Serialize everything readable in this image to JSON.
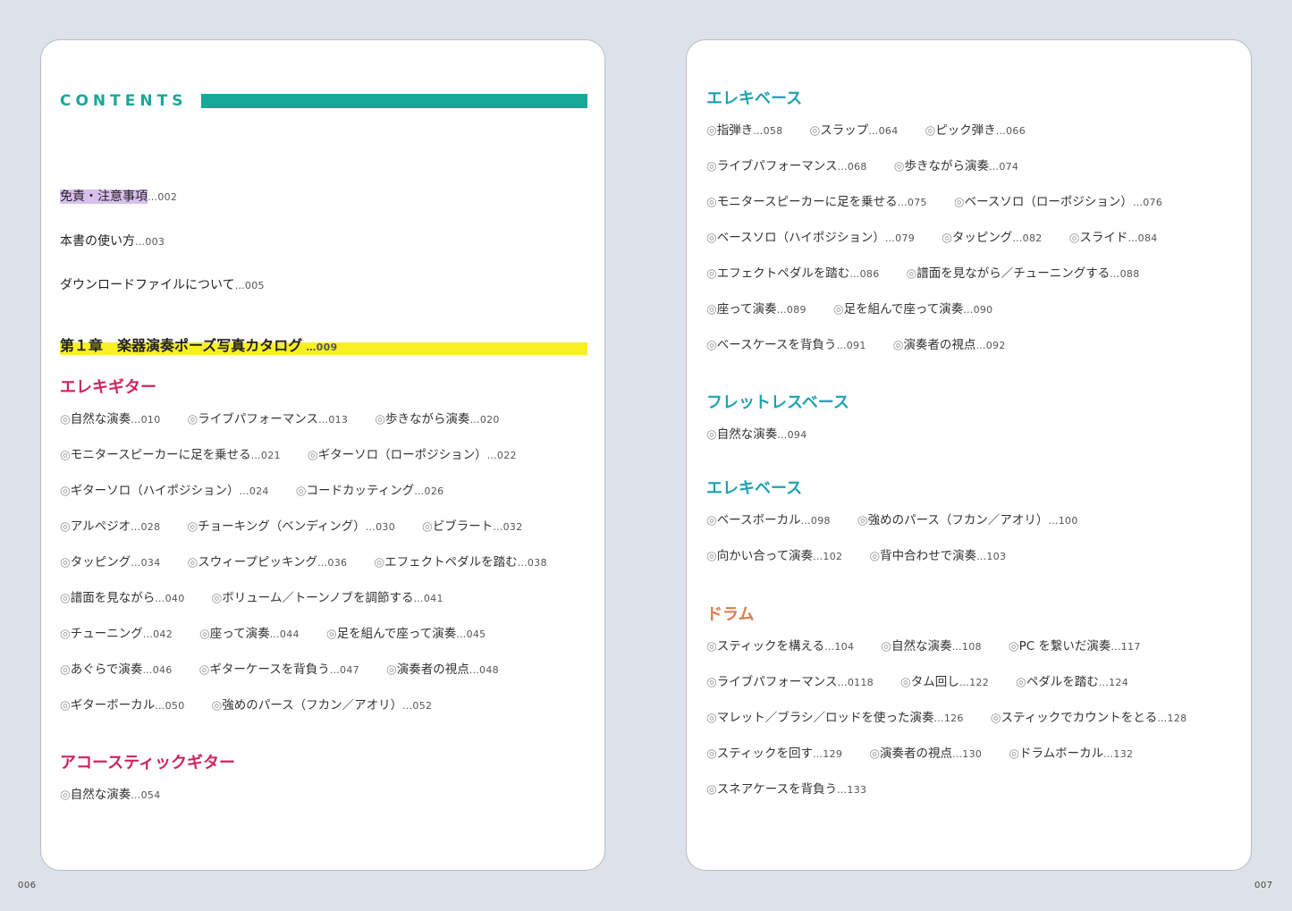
{
  "contents_title": "CONTENTS",
  "front_matter": [
    {
      "label": "免責・注意事項",
      "page": "002"
    },
    {
      "label": "本書の使い方",
      "page": "003"
    },
    {
      "label": "ダウンロードファイルについて",
      "page": "005"
    }
  ],
  "chapter": {
    "label": "第１章　楽器演奏ポーズ写真カタログ",
    "page": "009"
  },
  "sections": [
    {
      "title": "エレキギター",
      "rows": [
        [
          {
            "label": "自然な演奏",
            "page": "010"
          },
          {
            "label": "ライブパフォーマンス",
            "page": "013"
          },
          {
            "label": "歩きながら演奏",
            "page": "020"
          }
        ],
        [
          {
            "label": "モニタースピーカーに足を乗せる",
            "page": "021"
          },
          {
            "label": "ギターソロ（ローポジション）",
            "page": "022"
          }
        ],
        [
          {
            "label": "ギターソロ（ハイポジション）",
            "page": "024"
          },
          {
            "label": "コードカッティング",
            "page": "026"
          }
        ],
        [
          {
            "label": "アルペジオ",
            "page": "028"
          },
          {
            "label": "チョーキング（ベンディング）",
            "page": "030"
          },
          {
            "label": "ビブラート",
            "page": "032"
          }
        ],
        [
          {
            "label": "タッピング",
            "page": "034"
          },
          {
            "label": "スウィープピッキング",
            "page": "036"
          },
          {
            "label": "エフェクトペダルを踏む",
            "page": "038"
          }
        ],
        [
          {
            "label": "譜面を見ながら",
            "page": "040"
          },
          {
            "label": "ボリューム／トーンノブを調節する",
            "page": "041"
          }
        ],
        [
          {
            "label": "チューニング",
            "page": "042"
          },
          {
            "label": "座って演奏",
            "page": "044"
          },
          {
            "label": "足を組んで座って演奏",
            "page": "045"
          }
        ],
        [
          {
            "label": "あぐらで演奏",
            "page": "046"
          },
          {
            "label": "ギターケースを背負う",
            "page": "047"
          },
          {
            "label": "演奏者の視点",
            "page": "048"
          }
        ],
        [
          {
            "label": "ギターボーカル",
            "page": "050"
          },
          {
            "label": "強めのパース（フカン／アオリ）",
            "page": "052"
          }
        ]
      ]
    },
    {
      "title": "アコースティックギター",
      "rows": [
        [
          {
            "label": "自然な演奏",
            "page": "054"
          }
        ]
      ]
    },
    {
      "title": "エレキベース",
      "rows": [
        [
          {
            "label": "指弾き",
            "page": "058"
          },
          {
            "label": "スラップ",
            "page": "064"
          },
          {
            "label": "ピック弾き",
            "page": "066"
          }
        ],
        [
          {
            "label": "ライブパフォーマンス",
            "page": "068"
          },
          {
            "label": "歩きながら演奏",
            "page": "074"
          }
        ],
        [
          {
            "label": "モニタースピーカーに足を乗せる",
            "page": "075"
          },
          {
            "label": "ベースソロ（ローポジション）",
            "page": "076"
          }
        ],
        [
          {
            "label": "ベースソロ（ハイポジション）",
            "page": "079"
          },
          {
            "label": "タッピング",
            "page": "082"
          },
          {
            "label": "スライド",
            "page": "084"
          }
        ],
        [
          {
            "label": "エフェクトペダルを踏む",
            "page": "086"
          },
          {
            "label": "譜面を見ながら／チューニングする",
            "page": "088"
          }
        ],
        [
          {
            "label": "座って演奏",
            "page": "089"
          },
          {
            "label": "足を組んで座って演奏",
            "page": "090"
          }
        ],
        [
          {
            "label": "ベースケースを背負う",
            "page": "091"
          },
          {
            "label": "演奏者の視点",
            "page": "092"
          }
        ]
      ]
    },
    {
      "title": "フレットレスベース",
      "rows": [
        [
          {
            "label": "自然な演奏",
            "page": "094"
          }
        ]
      ]
    },
    {
      "title": "エレキベース",
      "rows": [
        [
          {
            "label": "ベースボーカル",
            "page": "098"
          },
          {
            "label": "強めのパース（フカン／アオリ）",
            "page": "100"
          }
        ],
        [
          {
            "label": "向かい合って演奏",
            "page": "102"
          },
          {
            "label": "背中合わせで演奏",
            "page": "103"
          }
        ]
      ]
    },
    {
      "title": "ドラム",
      "rows": [
        [
          {
            "label": "スティックを構える",
            "page": "104"
          },
          {
            "label": "自然な演奏",
            "page": "108"
          },
          {
            "label": "PC を繋いだ演奏",
            "page": "117"
          }
        ],
        [
          {
            "label": "ライブパフォーマンス",
            "page": "0118"
          },
          {
            "label": "タム回し",
            "page": "122"
          },
          {
            "label": "ペダルを踏む",
            "page": "124"
          }
        ],
        [
          {
            "label": "マレット／ブラシ／ロッドを使った演奏",
            "page": "126"
          },
          {
            "label": "スティックでカウントをとる",
            "page": "128"
          }
        ],
        [
          {
            "label": "スティックを回す",
            "page": "129"
          },
          {
            "label": "演奏者の視点",
            "page": "130"
          },
          {
            "label": "ドラムボーカル",
            "page": "132"
          }
        ],
        [
          {
            "label": "スネアケースを背負う",
            "page": "133"
          }
        ]
      ]
    }
  ],
  "folios": {
    "left": "006",
    "right": "007"
  },
  "colors": {
    "teal": "#18a899",
    "chapter_highlight": "#f8f022",
    "front_highlight": "#d9bff0",
    "magenta": "#d0225e",
    "cyan": "#1ba3b4",
    "orange": "#e07a4a"
  }
}
